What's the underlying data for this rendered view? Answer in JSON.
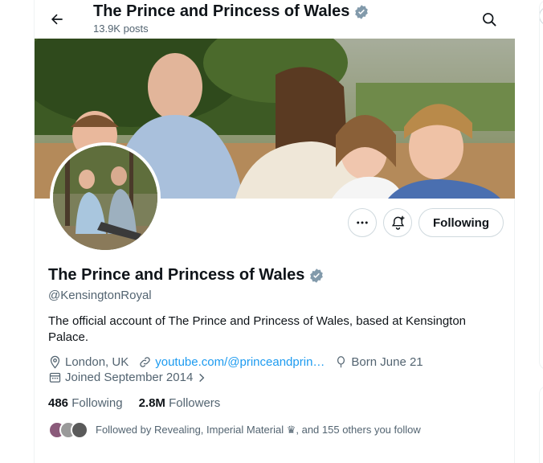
{
  "header": {
    "title": "The Prince and Princess of Wales",
    "posts_count": "13.9K posts"
  },
  "profile": {
    "display_name": "The Prince and Princess of Wales",
    "handle": "@KensingtonRoyal",
    "bio": "The official account of The Prince and Princess of Wales, based at Kensington Palace.",
    "location": "London, UK",
    "website": "youtube.com/@princeandprin…",
    "birthday": "Born June 21",
    "joined": "Joined September 2014",
    "following_count": "486",
    "following_label": "Following",
    "followers_count": "2.8M",
    "followers_label": "Followers",
    "followed_by": "Followed by Revealing, Imperial Material ♛, and 155 others you follow"
  },
  "actions": {
    "follow_state_label": "Following",
    "more_icon": "more-icon",
    "notify_icon": "bell-plus-icon"
  },
  "colors": {
    "accent": "#1d9bf0",
    "verified": "#829aab",
    "text_primary": "#0f1419",
    "text_secondary": "#536471"
  }
}
